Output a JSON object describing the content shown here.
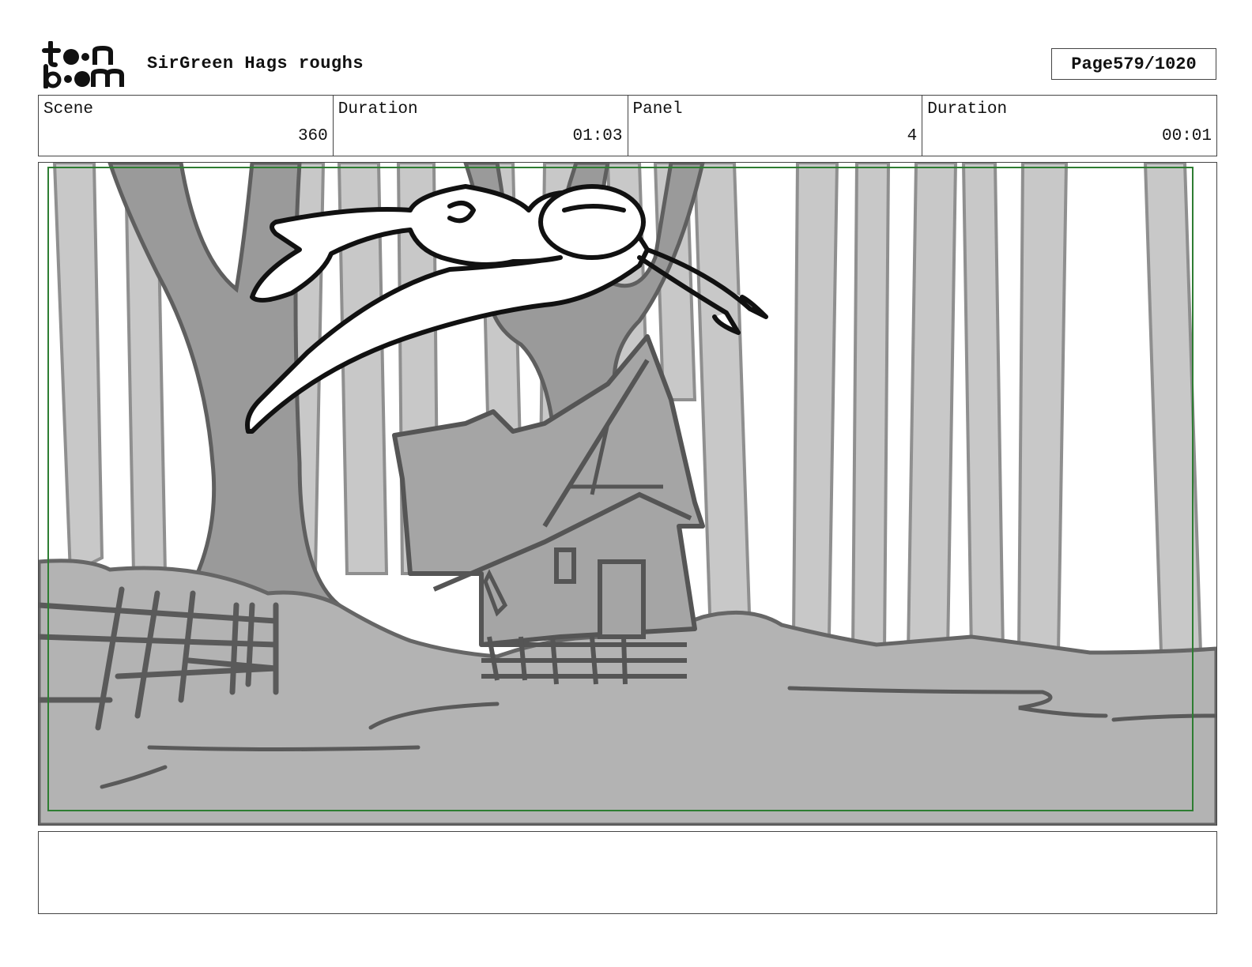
{
  "header": {
    "logo": {
      "icon": "toonboom-logo-icon",
      "lettering": "toon boom"
    },
    "project_title": "SirGreen Hags roughs",
    "page_label": "Page",
    "page_number": "579/1020"
  },
  "info": {
    "scene_label": "Scene",
    "scene_value": "360",
    "scene_duration_label": "Duration",
    "scene_duration_value": "01:03",
    "panel_label": "Panel",
    "panel_value": "4",
    "panel_duration_label": "Duration",
    "panel_duration_value": "00:01"
  },
  "panel": {
    "image": "storyboard-sketch-character-leaping-over-witch-house-in-forest",
    "safe_frame_color": "#2e7d32"
  },
  "notes": {
    "text": ""
  }
}
